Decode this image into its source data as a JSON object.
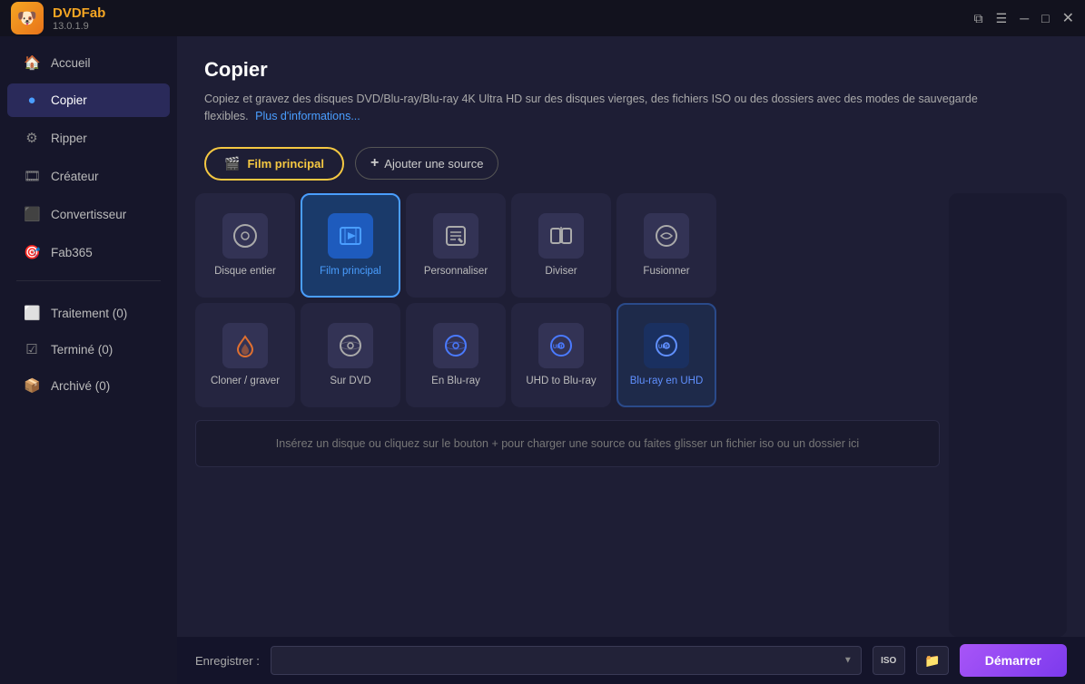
{
  "app": {
    "name_prefix": "DVD",
    "name_suffix": "Fab",
    "version": "13.0.1.9",
    "logo_emoji": "🐶"
  },
  "titlebar": {
    "controls": {
      "widget": "⧉",
      "menu": "☰",
      "minimize": "─",
      "maximize": "□",
      "close": "✕"
    }
  },
  "sidebar": {
    "items": [
      {
        "id": "accueil",
        "label": "Accueil",
        "icon": "🏠",
        "active": false
      },
      {
        "id": "copier",
        "label": "Copier",
        "icon": "🔵",
        "active": true
      },
      {
        "id": "ripper",
        "label": "Ripper",
        "icon": "⚙️",
        "active": false
      },
      {
        "id": "createur",
        "label": "Créateur",
        "icon": "🎞️",
        "active": false
      },
      {
        "id": "convertisseur",
        "label": "Convertisseur",
        "icon": "📋",
        "active": false
      },
      {
        "id": "fab365",
        "label": "Fab365",
        "icon": "🎯",
        "active": false
      }
    ],
    "bottom_items": [
      {
        "id": "traitement",
        "label": "Traitement (0)",
        "icon": "📋"
      },
      {
        "id": "termine",
        "label": "Terminé (0)",
        "icon": "✅"
      },
      {
        "id": "archive",
        "label": "Archivé (0)",
        "icon": "📦"
      }
    ]
  },
  "page": {
    "title": "Copier",
    "description": "Copiez et gravez des disques DVD/Blu-ray/Blu-ray 4K Ultra HD sur des disques vierges, des fichiers ISO ou des dossiers avec des modes de sauvegarde flexibles.",
    "more_info_link": "Plus d'informations..."
  },
  "actions": {
    "film_principal_label": "Film principal",
    "add_source_label": "Ajouter une source"
  },
  "modes_row1": [
    {
      "id": "disque-entier",
      "label": "Disque entier",
      "icon": "disc",
      "selected": false
    },
    {
      "id": "film-principal",
      "label": "Film principal",
      "icon": "film",
      "selected": true
    },
    {
      "id": "personnaliser",
      "label": "Personnaliser",
      "icon": "edit",
      "selected": false
    },
    {
      "id": "diviser",
      "label": "Diviser",
      "icon": "split",
      "selected": false
    },
    {
      "id": "fusionner",
      "label": "Fusionner",
      "icon": "merge",
      "selected": false
    }
  ],
  "modes_row2": [
    {
      "id": "cloner-graver",
      "label": "Cloner / graver",
      "icon": "burn",
      "selected": false
    },
    {
      "id": "sur-dvd",
      "label": "Sur DVD",
      "icon": "dvd",
      "selected": false
    },
    {
      "id": "en-bluray",
      "label": "En Blu-ray",
      "icon": "bluray",
      "selected": false
    },
    {
      "id": "uhd-to-bluray",
      "label": "UHD to Blu-ray",
      "icon": "uhdbd",
      "selected": false
    },
    {
      "id": "bluray-en-uhd",
      "label": "Blu-ray en UHD",
      "icon": "uhdbd2",
      "selected": false
    }
  ],
  "dropzone": {
    "text": "Insérez un disque ou cliquez sur le bouton +  pour charger une source ou faites glisser un fichier iso ou un dossier ici"
  },
  "bottombar": {
    "save_label": "Enregistrer :",
    "iso_label": "ISO",
    "start_label": "Démarrer"
  }
}
